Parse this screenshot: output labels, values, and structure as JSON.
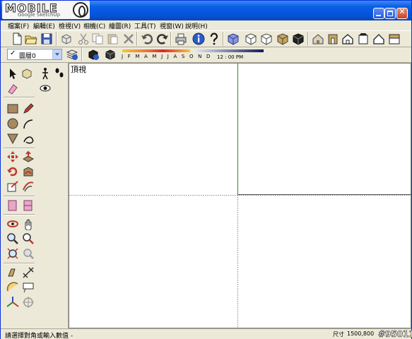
{
  "logo": {
    "text": "MOBILE",
    "subtext": "Google SketchUp"
  },
  "window": {
    "buttons": [
      "minimize",
      "maximize",
      "close"
    ]
  },
  "menu": [
    {
      "label": "檔案(F)"
    },
    {
      "label": "編輯(E)"
    },
    {
      "label": "檢視(V)"
    },
    {
      "label": "相機(C)"
    },
    {
      "label": "繪圖(R)"
    },
    {
      "label": "工具(T)"
    },
    {
      "label": "視窗(W)"
    },
    {
      "label": "說明(H)"
    }
  ],
  "toolbar1": {
    "icons": [
      "new-file-icon",
      "open-file-icon",
      "save-icon",
      "make-component-icon",
      "cut-icon",
      "copy-icon",
      "paste-icon",
      "erase-icon",
      "undo-icon",
      "redo-icon",
      "print-icon",
      "model-info-icon",
      "help-icon",
      "iso-view-icon",
      "top-view-icon",
      "front-view-icon",
      "right-view-icon",
      "back-view-icon",
      "left-view-icon",
      "house-xray-icon",
      "house-wire-icon",
      "house-hidden-icon",
      "house-shaded-icon",
      "house-textured-icon",
      "house-mono-icon"
    ]
  },
  "toolbar2": {
    "layer_check": "✓",
    "layer_value": "圖層0",
    "months": "J F M A M J J A S O N D",
    "time": "12 : 00 PM",
    "icons": [
      "layer-manager-icon",
      "shadow-settings-icon",
      "shadow-toggle-icon"
    ]
  },
  "viewport": {
    "label": "頂視"
  },
  "status": {
    "text": "請選擇對角或輸入數值 -",
    "measure_label": "尺寸",
    "measure_value": "1500,800"
  },
  "watermark": "#95011",
  "colors": {
    "titlebar": "#0a5fe3",
    "chrome": "#ece9d8",
    "green_axis": "#2a8a2a"
  }
}
